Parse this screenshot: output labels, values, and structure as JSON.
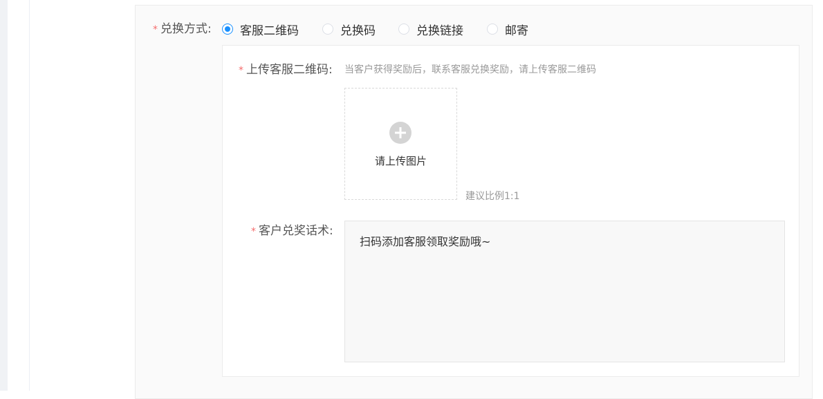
{
  "exchange": {
    "required_mark": "*",
    "label": "兑换方式:",
    "options": [
      {
        "label": "客服二维码",
        "checked": true
      },
      {
        "label": "兑换码",
        "checked": false
      },
      {
        "label": "兑换链接",
        "checked": false
      },
      {
        "label": "邮寄",
        "checked": false
      }
    ],
    "accent_color": "#1890ff"
  },
  "qr_upload": {
    "required_mark": "*",
    "label": "上传客服二维码:",
    "hint": "当客户获得奖励后，联系客服兑换奖励，请上传客服二维码",
    "button_text": "请上传图片",
    "button_icon": "plus-circle-icon",
    "ratio_hint": "建议比例1:1"
  },
  "speech": {
    "required_mark": "*",
    "label": "客户兑奖话术:",
    "value": "扫码添加客服领取奖励哦~"
  }
}
